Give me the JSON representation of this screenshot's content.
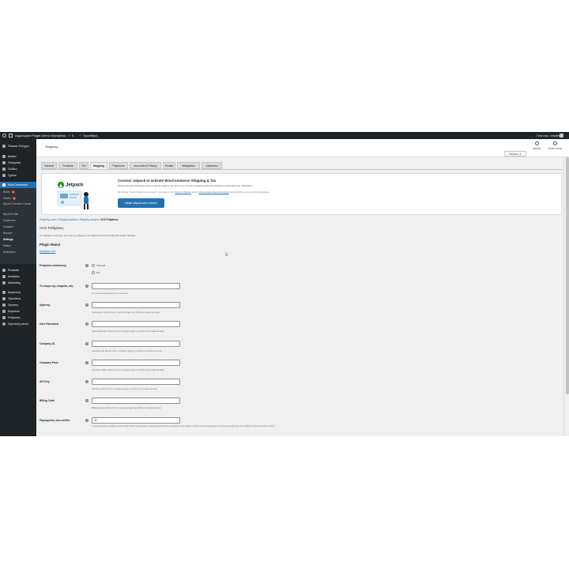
{
  "adminbar": {
    "site_name": "Δημιουργία Plugin Demo Wordpress",
    "comments_count": "0",
    "new_label": "Προσθήκη",
    "greeting": "Γεια σου, insider"
  },
  "sidebar": {
    "items": [
      {
        "label": "Πίνακας Ελέγχου"
      },
      {
        "label": "Άρθρα"
      },
      {
        "label": "Πολυμέσα"
      },
      {
        "label": "Σελίδες"
      },
      {
        "label": "Σχόλια"
      },
      {
        "label": "WooCommerce"
      }
    ],
    "woo_sub": [
      {
        "label": "Home",
        "badge": "1"
      },
      {
        "label": "Orders",
        "badge": "3"
      },
      {
        "label": "My ACS Voucher Control"
      },
      {
        "label": "My ACS Lists"
      },
      {
        "label": "Customers"
      },
      {
        "label": "Coupons"
      },
      {
        "label": "Reports"
      },
      {
        "label": "Settings"
      },
      {
        "label": "Status"
      },
      {
        "label": "Extensions"
      }
    ],
    "items_after": [
      {
        "label": "Products"
      },
      {
        "label": "Analytics"
      },
      {
        "label": "Marketing"
      },
      {
        "label": "Εμφάνιση"
      },
      {
        "label": "Πρόσθετα"
      },
      {
        "label": "Χρήστες"
      },
      {
        "label": "Εργαλεία"
      },
      {
        "label": "Ρυθμίσεις"
      },
      {
        "label": "Σύμπτυξη μενού"
      }
    ]
  },
  "header": {
    "title": "Shipping",
    "activity_label": "Activity",
    "finish_setup_label": "Finish setup",
    "help_label": "Βοήθεια ▼"
  },
  "tabs": [
    {
      "label": "General"
    },
    {
      "label": "Products"
    },
    {
      "label": "Tax"
    },
    {
      "label": "Shipping"
    },
    {
      "label": "Payments"
    },
    {
      "label": "Accounts & Privacy"
    },
    {
      "label": "Emails"
    },
    {
      "label": "Integration"
    },
    {
      "label": "Advanced"
    }
  ],
  "jetpack": {
    "logo_text": "Jetpack",
    "heading": "Connect Jetpack to activate WooCommerce Shipping & Tax",
    "description": "WooCommerce Shipping & Tax is almost ready to go! Once you connect Jetpack you'll have access to automated tax calculation.",
    "tos_prefix": "By clicking \"Install Jetpack and connect\", you agree to the",
    "tos_link1": "Terms of Service",
    "tos_mid": "and to",
    "tos_link2": "share certain data and settings",
    "tos_suffix": "with WordPress.com and/or third parties.",
    "button_label": "Install Jetpack and connect"
  },
  "breadcrumbs": {
    "items": [
      "Shipping zones",
      "Shipping options",
      "Shipping classes"
    ],
    "current": "ACS Ρυθμίσεις"
  },
  "settings": {
    "title": "ACS Ρυθμίσεις",
    "description": "Οι παρακάτω ενότητες είναι για τις ρυθμίσεις του WooCommerce Of MyACS plugin Settings",
    "manual_title": "Plugin Manul",
    "manual_link": "Κατέβασε εδώ",
    "mode_label": "Ρυθμίσεις εκτύπωσης",
    "mode_options": [
      "Thermal",
      "A4"
    ],
    "rows": [
      {
        "label": "Το όνομα της εταιρείας σας",
        "value": "",
        "desc": "Το όνομα θα εμφανίζεται στο voucher"
      },
      {
        "label": "Χρήστης",
        "value": "",
        "desc": "Username, δίνεται από το τεχνικό τμήμα της ACS για τα web services"
      },
      {
        "label": "User Password",
        "value": "",
        "desc": "User Password, δίνεται από το τεχνικό τμήμα της ACS για τα web services"
      },
      {
        "label": "Company ID",
        "value": "",
        "desc": "Company ID, δίνεται από το τεχνικό τμήμα της ACS για τα web services"
      },
      {
        "label": "Company Pass",
        "value": "",
        "desc": "Company Pass, δίνεται από το τεχνικό τμήμα της ACS για τα web services"
      },
      {
        "label": "API Key",
        "value": "",
        "desc": "API Key, δίνεται από το τεχνικό τμήμα της ACS για τα web services"
      },
      {
        "label": "Billing Code",
        "value": "",
        "desc": "Billing Code, δίνεται από το τεχνικό τμήμα της ACS για τα web services"
      },
      {
        "label": "Παραγγελίες ανα σελίδα",
        "value": "40",
        "desc": ""
      }
    ],
    "long_desc": "Ο προεπιλεγμένος αριθμός είναι 40. Εάν θέλετε περισσότερες παραγγελίες θα πρέπει να αυξήσετε τον αριθμό, ωστόσο αυτό θα επηρεάσει την ταχύτητα φόρτωσης της σελίδας του ACS Voucher Control."
  },
  "colors": {
    "admin_dark": "#1d2327",
    "accent": "#2271b1",
    "jetpack_green": "#069e08",
    "badge_red": "#d63638"
  }
}
